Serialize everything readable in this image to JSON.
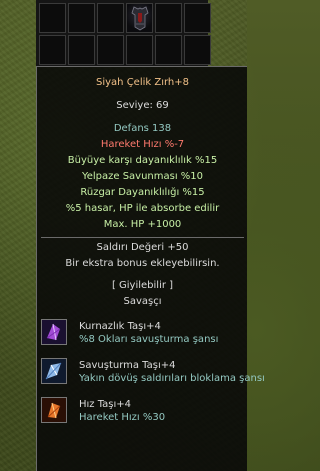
{
  "item": {
    "name": "Siyah Çelik Zırh+8",
    "level": "Seviye: 69",
    "defense": "Defans 138",
    "attack_speed": "Hareket Hızı %-7"
  },
  "bonuses": [
    "Büyüye karşı dayanıklılık %15",
    "Yelpaze Savunması %10",
    "Rüzgar Dayanıklılığı %15",
    "%5 hasar, HP ile absorbe edilir",
    "Max. HP +1000"
  ],
  "attack_value": "Saldırı Değeri +50",
  "extra_bonus": "Bir ekstra bonus ekleyebilirsin.",
  "wearable": "[ Giyilebilir ]",
  "class": "Savaşçı",
  "stones": [
    {
      "name": "Kurnazlık Taşı+4",
      "bonus": "%8 Okları savuşturma şansı",
      "icon": "cunning-stone-icon"
    },
    {
      "name": "Savuşturma Taşı+4",
      "bonus": "Yakın dövüş saldırıları bloklama şansı",
      "icon": "parry-stone-icon"
    },
    {
      "name": "Hız Taşı+4",
      "bonus": "Hareket Hızı %30",
      "icon": "speed-stone-icon"
    }
  ],
  "colors": {
    "title": "#f1c088",
    "normal": "#dcdcdc",
    "stat": "#94c9c2",
    "negative": "#ff7a6e",
    "bonus": "#c8f0a6"
  }
}
